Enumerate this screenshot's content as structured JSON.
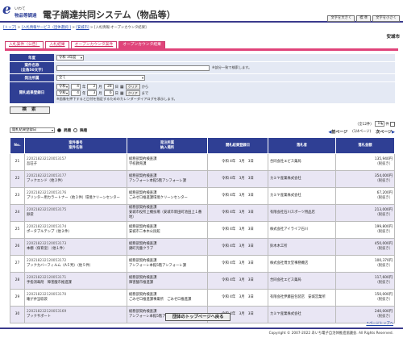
{
  "logo": {
    "mark": "e",
    "line1": "いわて",
    "line2": "物品等調達"
  },
  "header": {
    "title": "電子調達共同システム（物品等）"
  },
  "font_buttons": [
    "文字を大きく",
    "標 準",
    "文字を小さく"
  ],
  "breadcrumb": {
    "top": "[トップ]",
    "sep1": " > ",
    "service": "[入札情報サービス（団体選択）]",
    "sep2": " > ",
    "org": "[安城市]",
    "sep3": " > ",
    "current": "[入札情報-オープンカウンタ結果]"
  },
  "org_name": "安城市",
  "tabs": [
    "入札案件（公告）",
    "入札結果",
    "オープンカウンタ案件",
    "オープンカウンタ結果"
  ],
  "form": {
    "year_label": "年度",
    "year_value": "令和 3年度",
    "case_name_label": "案件名称",
    "case_name_sub": "（全角50文字）",
    "case_name_note": "※部分一致で検索します。",
    "dept_label": "発注所属",
    "dept_value": "全て",
    "date_label": "開札結果登録日",
    "from": {
      "era": "令和",
      "year": "4",
      "month": "2",
      "day": "28"
    },
    "to": {
      "era": "令和",
      "year": "4",
      "month": "3",
      "day": "6"
    },
    "unit_year": "年",
    "unit_month": "月",
    "unit_day": "日",
    "clear_label": "クリア",
    "from_suffix": "から",
    "to_suffix": "まで",
    "cal_note": "※画像を押下すると日付を指定するためのカレンダーダイアログを表示します。",
    "submit": "検 索"
  },
  "sort": {
    "select": "開札結果登録日",
    "asc": "昇順",
    "desc": "降順"
  },
  "paging": {
    "info": "（全12件）",
    "per_page": "10",
    "per_unit": "件",
    "page_label": "(1/4ページ)",
    "prev": "前ページ",
    "next": "次ページ"
  },
  "table": {
    "headers": {
      "no": "No.",
      "case_no": "案件番号",
      "case_name": "案件名称",
      "office": "発注所属",
      "delivery": "納入場所",
      "date": "開札結果登録日",
      "winner": "落札者",
      "amount": "落札金額"
    },
    "rows": [
      {
        "no": "21",
        "case_no": "220218232120053157",
        "name": "吾荘子",
        "office": "総務部契約検査課",
        "place": "学校教育課",
        "date": "令和 4年　3月　3日",
        "winner": "合同会社エビス薬局",
        "amount": "135,940円",
        "tax": "（税抜き）"
      },
      {
        "no": "22",
        "case_no": "220218232120053177",
        "name": "ブックエンド（他３件）",
        "office": "総務部契約検査課",
        "place": "アンフォーレ本館5階アンフォーレ課",
        "date": "令和 4年　3月　3日",
        "winner": "カミヤ産業株式会社",
        "amount": "354,000円",
        "tax": "（税抜き）"
      },
      {
        "no": "23",
        "case_no": "220218232120053176",
        "name": "プリンター用カラートナー（他３件）環境クリーンセンター",
        "office": "総務部契約検査課",
        "place": "ごみゼロ推進課環境クリーンセンター",
        "date": "令和 4年　3月　3日",
        "winner": "カミヤ産業株式会社",
        "amount": "67,200円",
        "tax": "（税抜き）"
      },
      {
        "no": "24",
        "case_no": "220218232120053175",
        "name": "卵袋",
        "office": "総務部契約検査課",
        "place": "安城市役所上機技場（安城市新田町池田上１番地）",
        "date": "令和 4年　3月　3日",
        "winner": "有限会社石川スポーツ用品店",
        "amount": "213,000円",
        "tax": "（税抜き）"
      },
      {
        "no": "25",
        "case_no": "220218232120053174",
        "name": "ポータブルテンプ（他２件）",
        "office": "総務部契約検査課",
        "place": "安城市二本木公民館",
        "date": "令和 4年　3月　3日",
        "winner": "株式会社アイライフ石川",
        "amount": "199,800円",
        "tax": "（税抜き）"
      },
      {
        "no": "26",
        "case_no": "220218232120053173",
        "name": "本棚（保育室）（他１件）",
        "office": "総務部契約検査課",
        "place": "錦町児童クラブ",
        "date": "令和 4年　3月　3日",
        "winner": "鈴木木工所",
        "amount": "450,000円",
        "tax": "（税抜き）"
      },
      {
        "no": "27",
        "case_no": "220218232120053172",
        "name": "ブックカバーフィルム（A５判）（他５件）",
        "office": "総務部契約検査課",
        "place": "アンフォーレ本館5階アンフォーレ課",
        "date": "令和 4年　3月　3日",
        "winner": "株式会社博文堂事務機店",
        "amount": "100,370円",
        "tax": "（税抜き）"
      },
      {
        "no": "28",
        "case_no": "220218232120053171",
        "name": "手指消毒剤　障害酸市推進課",
        "office": "総務部契約検査課",
        "place": "障害酸市推進課",
        "date": "令和 4年　3月　3日",
        "winner": "合同会社エビス薬局",
        "amount": "117,600円",
        "tax": "（税抜き）"
      },
      {
        "no": "29",
        "case_no": "220218232120053170",
        "name": "睡が弁当収袋",
        "office": "総務部契約検査課",
        "place": "ごみゼロ推進課事業所　ごみゼロ推進課",
        "date": "令和 4年　3月　3日",
        "winner": "有限会社伊藤田包装店　安城営業所",
        "amount": "150,000円",
        "tax": "（税抜き）"
      },
      {
        "no": "30",
        "case_no": "220218232120053169",
        "name": "ブックサポート",
        "office": "総務部契約検査課",
        "place": "アンフォーレ本館5階アンフォーレ課",
        "date": "令和 4年　3月　3日",
        "winner": "カミヤ産業株式会社",
        "amount": "240,000円",
        "tax": "（税抜き）"
      }
    ]
  },
  "back_button": "団体のトップページへ戻る",
  "to_top": "↑ページトップへ",
  "copyright": "Copyright © 2007-2022 あいち電子自治体推進協議会. All Rights Reserved."
}
